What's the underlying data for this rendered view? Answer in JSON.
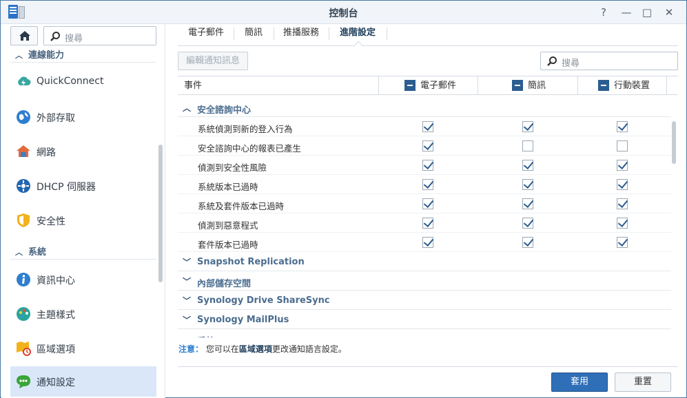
{
  "window": {
    "title": "控制台",
    "help": "?",
    "minimize": "—",
    "maximize": "□",
    "close": "✕"
  },
  "sidebar": {
    "search_placeholder": "搜尋",
    "section_connectivity": "連線能力",
    "section_system": "系統",
    "items": [
      {
        "label": "QuickConnect",
        "icon": "quickconnect-icon"
      },
      {
        "label": "外部存取",
        "icon": "external-access-icon"
      },
      {
        "label": "網路",
        "icon": "network-icon"
      },
      {
        "label": "DHCP 伺服器",
        "icon": "dhcp-icon"
      },
      {
        "label": "安全性",
        "icon": "security-shield-icon"
      },
      {
        "label": "資訊中心",
        "icon": "info-icon"
      },
      {
        "label": "主題樣式",
        "icon": "theme-palette-icon"
      },
      {
        "label": "區域選項",
        "icon": "regional-options-icon"
      },
      {
        "label": "通知設定",
        "icon": "notification-icon"
      }
    ]
  },
  "tabs": [
    "電子郵件",
    "簡訊",
    "推播服務",
    "進階設定"
  ],
  "toolbar": {
    "edit_label": "編輯通知訊息",
    "search_placeholder": "搜尋"
  },
  "grid": {
    "headers": {
      "event": "事件",
      "email": "電子郵件",
      "sms": "簡訊",
      "mobile": "行動裝置"
    },
    "groups": [
      {
        "title": "安全諮詢中心",
        "expanded": true,
        "rows": [
          {
            "label": "系統偵測到新的登入行為",
            "email": true,
            "sms": true,
            "mobile": true
          },
          {
            "label": "安全諮詢中心的報表已產生",
            "email": true,
            "sms": false,
            "mobile": false
          },
          {
            "label": "偵測到安全性風險",
            "email": true,
            "sms": true,
            "mobile": true
          },
          {
            "label": "系統版本已過時",
            "email": true,
            "sms": true,
            "mobile": true
          },
          {
            "label": "系統及套件版本已過時",
            "email": true,
            "sms": true,
            "mobile": true
          },
          {
            "label": "偵測到惡意程式",
            "email": true,
            "sms": true,
            "mobile": true
          },
          {
            "label": "套件版本已過時",
            "email": true,
            "sms": true,
            "mobile": true
          }
        ]
      },
      {
        "title": "Snapshot Replication",
        "expanded": false
      },
      {
        "title": "內部儲存空間",
        "expanded": false
      },
      {
        "title": "Synology Drive ShareSync",
        "expanded": false
      },
      {
        "title": "Synology MailPlus",
        "expanded": false
      },
      {
        "title": "系統",
        "expanded": true
      }
    ]
  },
  "note": {
    "label": "注意：",
    "text_before": " 您可以在",
    "link": "區域選項",
    "text_after": "更改通知語言設定。"
  },
  "footer": {
    "apply_label": "套用",
    "reset_label": "重置"
  },
  "colors": {
    "accent": "#2f6fb7",
    "check": "#2b5d91",
    "active_item": "#d9e7f8"
  }
}
